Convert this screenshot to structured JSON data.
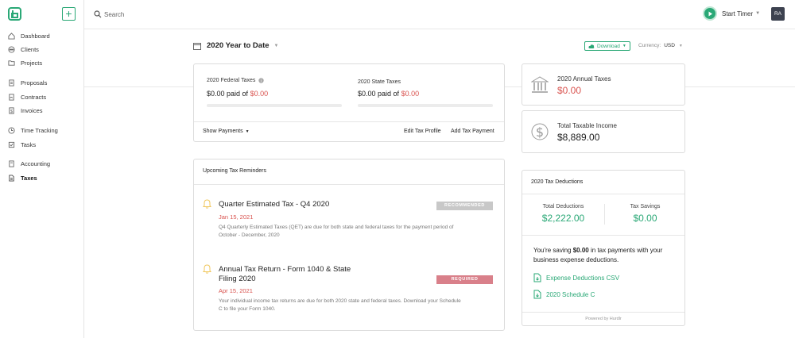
{
  "sidebar": {
    "items": [
      {
        "label": "Dashboard",
        "icon": "home-icon"
      },
      {
        "label": "Clients",
        "icon": "clients-icon"
      },
      {
        "label": "Projects",
        "icon": "folder-icon"
      },
      {
        "label": "Proposals",
        "icon": "document-icon"
      },
      {
        "label": "Contracts",
        "icon": "contract-icon"
      },
      {
        "label": "Invoices",
        "icon": "invoice-icon"
      },
      {
        "label": "Time Tracking",
        "icon": "clock-icon"
      },
      {
        "label": "Tasks",
        "icon": "tasks-icon"
      },
      {
        "label": "Accounting",
        "icon": "accounting-icon"
      },
      {
        "label": "Taxes",
        "icon": "taxes-icon",
        "active": true
      }
    ],
    "add_label": "+"
  },
  "topbar": {
    "search_placeholder": "Search",
    "timer_label": "Start Timer",
    "avatar_initials": "RA"
  },
  "header": {
    "period": "2020 Year to Date",
    "download_label": "Download",
    "currency_label": "Currency:",
    "currency_value": "USD"
  },
  "payments": {
    "federal_label": "2020 Federal Taxes",
    "federal_paid_prefix": "$0.00 paid of",
    "federal_total": "$0.00",
    "state_label": "2020 State Taxes",
    "state_paid_prefix": "$0.00 paid of",
    "state_total": "$0.00",
    "show_payments": "Show Payments",
    "edit_profile": "Edit Tax Profile",
    "add_payment": "Add Tax Payment"
  },
  "reminders": {
    "title": "Upcoming Tax Reminders",
    "items": [
      {
        "title": "Quarter Estimated Tax - Q4 2020",
        "date": "Jan 15, 2021",
        "desc_line1": "Q4 Quarterly Estimated Taxes (QET) are due for both state and federal taxes for the payment period of",
        "desc_line2": "October - December, 2020",
        "badge": "RECOMMENDED"
      },
      {
        "title_line1": "Annual Tax Return - Form 1040 & State",
        "title_line2": "Filing 2020",
        "date": "Apr 15, 2021",
        "desc_line1": "Your individual income tax returns are due for both 2020 state and federal taxes. Download your Schedule",
        "desc_line2": "C to file your Form 1040.",
        "badge": "REQUIRED"
      }
    ]
  },
  "annual": {
    "label": "2020 Annual Taxes",
    "value": "$0.00"
  },
  "income": {
    "label": "Total Taxable Income",
    "value": "$8,889.00"
  },
  "deductions": {
    "title": "2020 Tax Deductions",
    "total_label": "Total Deductions",
    "total_value": "$2,222.00",
    "savings_label": "Tax Savings",
    "savings_value": "$0.00",
    "msg_prefix": "You're saving",
    "msg_amount": "$0.00",
    "msg_suffix": "in tax payments with your",
    "msg_line2": "business expense deductions.",
    "csv_link": "Expense Deductions CSV",
    "schedule_link": "2020 Schedule C",
    "powered": "Powered by Hurdlr"
  },
  "colors": {
    "accent": "#2aa876",
    "danger": "#d9534f",
    "recommended_badge": "#c8c8c8",
    "required_badge": "#d9808a"
  }
}
